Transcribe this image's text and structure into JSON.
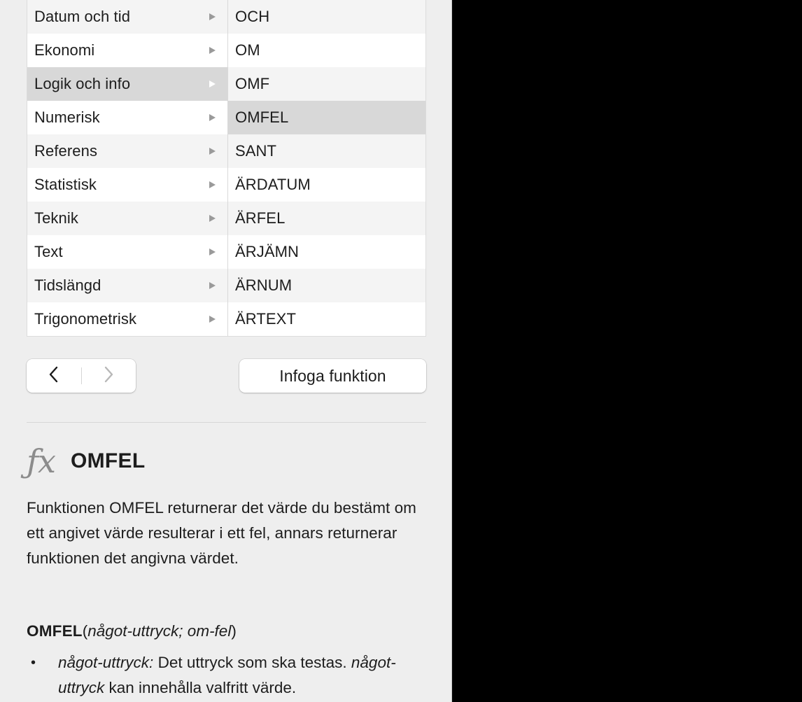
{
  "browser": {
    "categories": [
      {
        "label": "Datum och tid",
        "selected": false
      },
      {
        "label": "Ekonomi",
        "selected": false
      },
      {
        "label": "Logik och info",
        "selected": true
      },
      {
        "label": "Numerisk",
        "selected": false
      },
      {
        "label": "Referens",
        "selected": false
      },
      {
        "label": "Statistisk",
        "selected": false
      },
      {
        "label": "Teknik",
        "selected": false
      },
      {
        "label": "Text",
        "selected": false
      },
      {
        "label": "Tidslängd",
        "selected": false
      },
      {
        "label": "Trigonometrisk",
        "selected": false
      }
    ],
    "functions": [
      {
        "label": "OCH",
        "selected": false
      },
      {
        "label": "OM",
        "selected": false
      },
      {
        "label": "OMF",
        "selected": false
      },
      {
        "label": "OMFEL",
        "selected": true
      },
      {
        "label": "SANT",
        "selected": false
      },
      {
        "label": "ÄRDATUM",
        "selected": false
      },
      {
        "label": "ÄRFEL",
        "selected": false
      },
      {
        "label": "ÄRJÄMN",
        "selected": false
      },
      {
        "label": "ÄRNUM",
        "selected": false
      },
      {
        "label": "ÄRTEXT",
        "selected": false
      }
    ]
  },
  "controls": {
    "back_icon": "chevron-left-icon",
    "forward_icon": "chevron-right-icon",
    "back_enabled": true,
    "forward_enabled": false,
    "insert_label": "Infoga funktion"
  },
  "detail": {
    "fx_glyph": "ƒx",
    "function_name": "OMFEL",
    "description": "Funktionen OMFEL returnerar det värde du bestämt om ett angivet värde resulterar i ett fel, annars returnerar funktionen det angivna värdet.",
    "syntax": {
      "name": "OMFEL",
      "open_paren": "(",
      "arguments": "något-uttryck; om-fel",
      "close_paren": ")"
    },
    "parameters": [
      {
        "bullet": "•",
        "term": "något-uttryck:",
        "text": " Det uttryck som ska testas. ",
        "term2": "något-uttryck",
        "text2": " kan innehålla valfritt värde."
      }
    ]
  },
  "colors": {
    "panel_background": "#eeeeee",
    "row_odd": "#f4f4f4",
    "row_even": "#ffffff",
    "row_selected": "#d8d8d8",
    "text": "#1d1d1d",
    "disclosure_gray": "#9a9a9a",
    "disclosure_selected": "#ffffff"
  }
}
